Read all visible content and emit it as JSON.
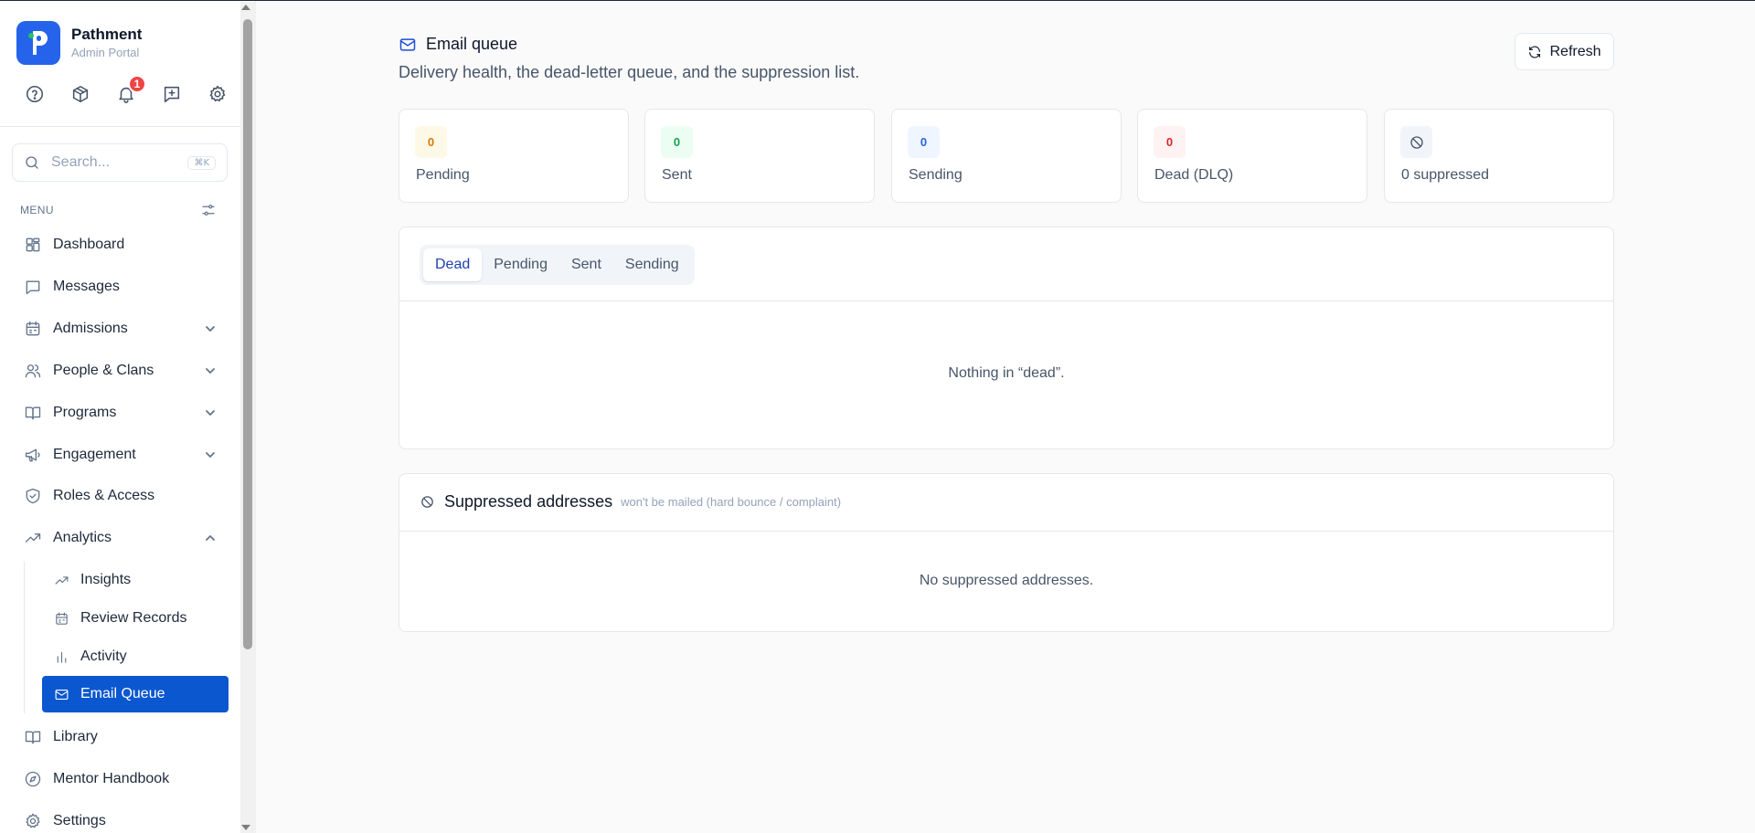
{
  "brand": {
    "name": "Pathment",
    "subtitle": "Admin Portal",
    "logo_letter": "P",
    "color": "#2563eb"
  },
  "toolbar": {
    "icons": [
      "help-circle-icon",
      "package-icon",
      "bell-icon",
      "message-plus-icon",
      "gear-icon"
    ],
    "notification_count": "1"
  },
  "search": {
    "placeholder": "Search...",
    "shortcut": "⌘K"
  },
  "menu": {
    "label": "MENU",
    "items": [
      {
        "label": "Dashboard",
        "icon": "dashboard-icon"
      },
      {
        "label": "Messages",
        "icon": "message-icon"
      },
      {
        "label": "Admissions",
        "icon": "calendar-icon",
        "expandable": true
      },
      {
        "label": "People & Clans",
        "icon": "users-icon",
        "expandable": true
      },
      {
        "label": "Programs",
        "icon": "book-open-icon",
        "expandable": true
      },
      {
        "label": "Engagement",
        "icon": "megaphone-icon",
        "expandable": true
      },
      {
        "label": "Roles & Access",
        "icon": "shield-check-icon"
      },
      {
        "label": "Analytics",
        "icon": "trending-up-icon",
        "expandable": true,
        "expanded": true
      }
    ],
    "analytics_sub": [
      {
        "label": "Insights",
        "icon": "trending-up-icon"
      },
      {
        "label": "Review Records",
        "icon": "calendar-icon"
      },
      {
        "label": "Activity",
        "icon": "bar-chart-icon"
      },
      {
        "label": "Email Queue",
        "icon": "mail-icon",
        "active": true
      }
    ],
    "bottom_items": [
      {
        "label": "Library",
        "icon": "book-open-icon"
      },
      {
        "label": "Mentor Handbook",
        "icon": "compass-icon"
      },
      {
        "label": "Settings",
        "icon": "gear-icon"
      }
    ]
  },
  "header": {
    "title": "Email queue",
    "subtitle": "Delivery health, the dead-letter queue, and the suppression list.",
    "refresh_label": "Refresh"
  },
  "stats": [
    {
      "value": "0",
      "label": "Pending",
      "bg": "#fef9e7",
      "fg": "#d97706"
    },
    {
      "value": "0",
      "label": "Sent",
      "bg": "#ecfdf3",
      "fg": "#16a34a"
    },
    {
      "value": "0",
      "label": "Sending",
      "bg": "#eff6ff",
      "fg": "#2563eb"
    },
    {
      "value": "0",
      "label": "Dead (DLQ)",
      "bg": "#fef2f2",
      "fg": "#dc2626"
    },
    {
      "value": "",
      "label": "0 suppressed",
      "bg": "#f1f5f9",
      "fg": "#475569",
      "icon": "ban-icon"
    }
  ],
  "queue_tabs": {
    "tabs": [
      "Dead",
      "Pending",
      "Sent",
      "Sending"
    ],
    "active": "Dead",
    "empty_message": "Nothing in “dead”."
  },
  "suppressed": {
    "title": "Suppressed addresses",
    "note": "won't be mailed (hard bounce / complaint)",
    "empty_message": "No suppressed addresses."
  },
  "colors": {
    "accent": "#0b57d0",
    "badge": "#ef4444"
  }
}
